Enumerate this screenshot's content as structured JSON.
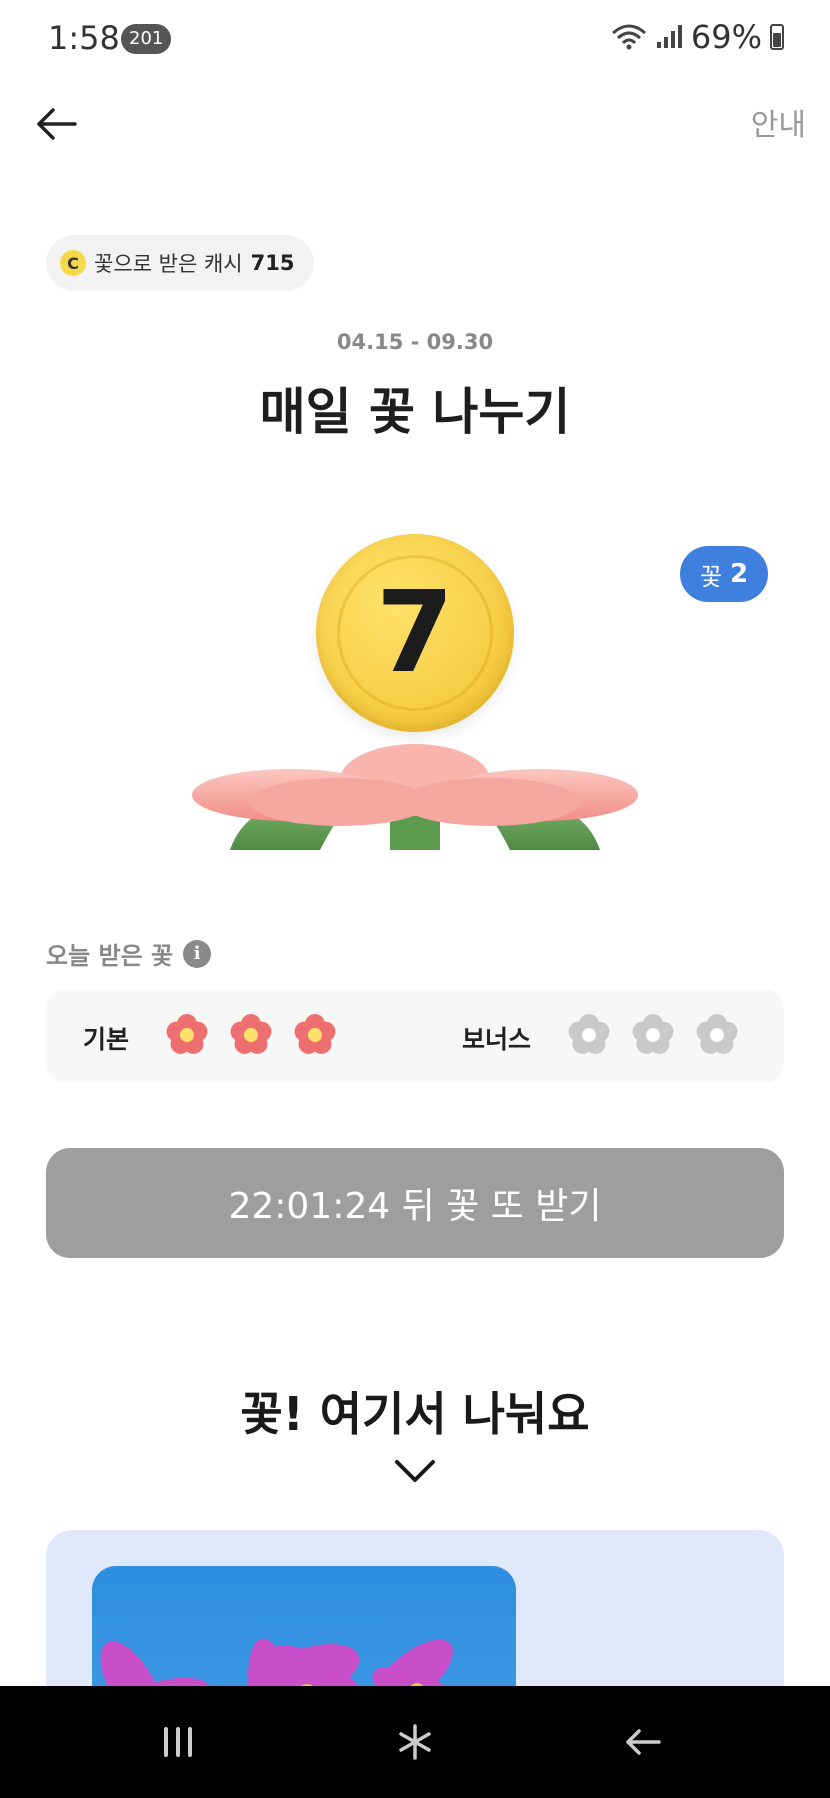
{
  "status_bar": {
    "time": "1:58",
    "notification_count": "201",
    "battery": "69%"
  },
  "header": {
    "guide_label": "안내"
  },
  "cash": {
    "label": "꽃으로 받은 캐시",
    "value": "715",
    "coin_letter": "C"
  },
  "event": {
    "period": "04.15 - 09.30",
    "title": "매일 꽃 나누기",
    "coin_number": "7"
  },
  "flower_count": {
    "label": "꽃",
    "value": "2"
  },
  "today": {
    "label": "오늘 받은 꽃",
    "basic_label": "기본",
    "bonus_label": "보너스",
    "basic_received": 3,
    "bonus_received": 0,
    "slots_each": 3
  },
  "timer_button": {
    "label": "22:01:24 뒤 꽃 또 받기"
  },
  "share": {
    "title": "꽃! 여기서 나눠요"
  },
  "colors": {
    "accent_blue": "#3f7fdd",
    "coin_yellow": "#f7d04a",
    "flower_pink": "#ee6f6f",
    "flower_gray": "#c9c9c9",
    "button_gray": "#9e9e9e",
    "card_bg": "#dfe9fb"
  },
  "icons": {
    "back": "arrow-left-icon",
    "info": "info-icon",
    "chevron": "chevron-down-icon",
    "nav_recent": "recent-apps-icon",
    "nav_home": "home-icon",
    "nav_back": "back-icon"
  }
}
